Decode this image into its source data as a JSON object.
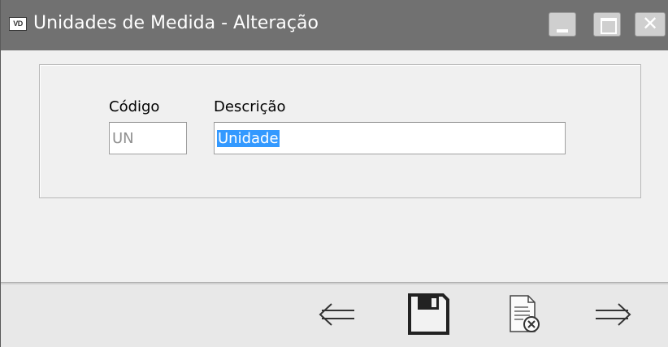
{
  "window": {
    "app_icon_text": "VD",
    "title": "Unidades de Medida - Alteração"
  },
  "form": {
    "codigo_label": "Código",
    "codigo_value": "UN",
    "descricao_label": "Descrição",
    "descricao_value": "Unidade"
  },
  "toolbar": {
    "buttons": [
      {
        "icon": "arrow-left-icon",
        "label": "previous"
      },
      {
        "icon": "save-icon",
        "label": "save"
      },
      {
        "icon": "cancel-document-icon",
        "label": "cancel"
      },
      {
        "icon": "arrow-right-icon",
        "label": "next"
      }
    ]
  },
  "colors": {
    "titlebar": "#717171",
    "selection": "#3399ff",
    "window_bg": "#f0f0f0"
  }
}
